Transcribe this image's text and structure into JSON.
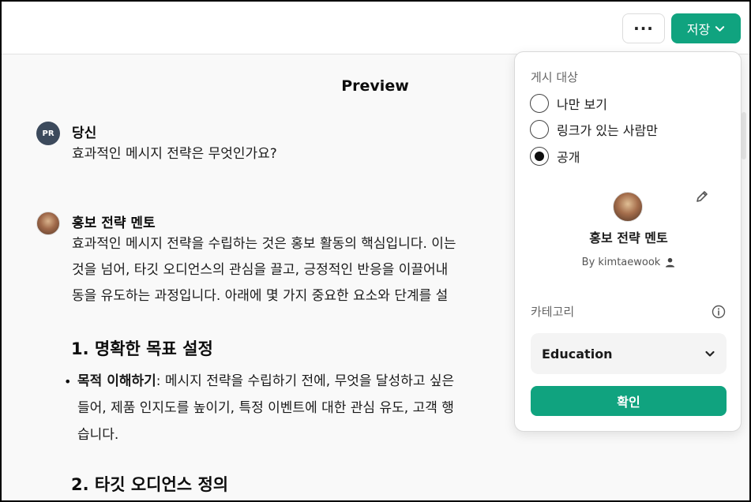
{
  "header": {
    "more_label": "···",
    "save_label": "저장"
  },
  "preview": {
    "title": "Preview",
    "user": {
      "avatar_text": "PR",
      "name": "당신",
      "message": "효과적인 메시지 전략은 무엇인가요?"
    },
    "bot": {
      "name": "홍보 전략 멘토",
      "lines": [
        "효과적인 메시지 전략을 수립하는 것은 홍보 활동의 핵심입니다. 이는",
        "것을 넘어, 타깃 오디언스의 관심을 끌고, 긍정적인 반응을 이끌어내",
        "동을 유도하는 과정입니다. 아래에 몇 가지 중요한 요소와 단계를 설"
      ],
      "heading1": "1. 명확한 목표 설정",
      "bullet1": {
        "bold": "목적 이해하기",
        "rest": ": 메시지 전략을 수립하기 전에, 무엇을 달성하고 싶은",
        "line2": "들어, 제품 인지도를 높이기, 특정 이벤트에 대한 관심 유도, 고객 행",
        "line3": "습니다."
      },
      "heading2": "2. 타깃 오디언스 정의"
    }
  },
  "publish_panel": {
    "section_label": "게시 대상",
    "options": [
      {
        "label": "나만 보기",
        "selected": false
      },
      {
        "label": "링크가 있는 사람만",
        "selected": false
      },
      {
        "label": "공개",
        "selected": true
      }
    ],
    "gpt_name": "홍보 전략 멘토",
    "author": "By kimtaewook",
    "category_label": "카테고리",
    "category_value": "Education",
    "confirm_label": "확인"
  },
  "colors": {
    "accent": "#10a37f"
  }
}
